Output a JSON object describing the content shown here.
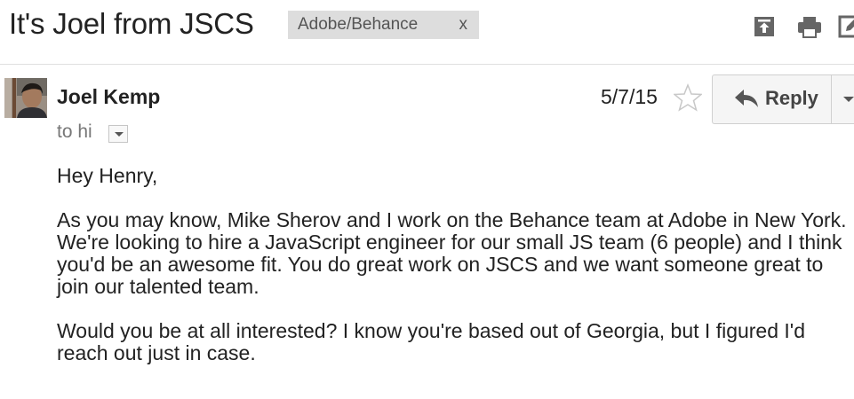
{
  "header": {
    "subject": "It's Joel from JSCS",
    "label": "Adobe/Behance",
    "label_remove": "x",
    "icons": [
      "archive-upload-icon",
      "print-icon",
      "open-in-new-window-icon"
    ]
  },
  "message": {
    "sender_name": "Joel Kemp",
    "to_line": "to hi",
    "date": "5/7/15",
    "reply_label": "Reply",
    "body": {
      "greeting": "Hey Henry,",
      "paragraph1": "As you may know, Mike Sherov and I work on the Behance team at Adobe in New York. We're looking to hire a JavaScript engineer for our small JS team (6 people) and I think you'd be an awesome fit. You do great work on JSCS and we want someone great to join our talented team.",
      "paragraph2": "Would you be at all interested? I know you're based out of Georgia, but I figured I'd reach out just in case."
    }
  },
  "colors": {
    "label_bg": "#dddddd",
    "text": "#222222",
    "muted_text": "#777777",
    "button_bg": "#f5f5f5",
    "star_outline": "#c8c8c8"
  }
}
